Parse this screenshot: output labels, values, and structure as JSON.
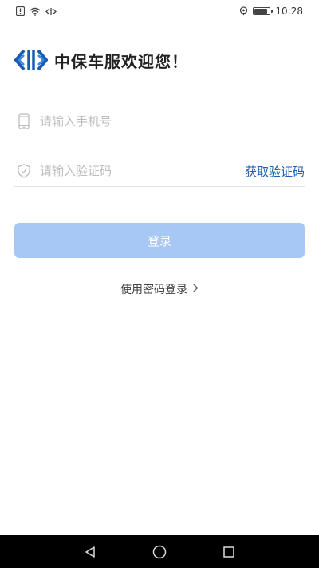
{
  "status_bar": {
    "time": "10:28",
    "icons": [
      "alert-icon",
      "wifi-icon",
      "data-icon",
      "location-icon",
      "battery-icon"
    ],
    "battery_level": 0.9
  },
  "header": {
    "logo": "brand-logo-icon",
    "welcome_text": "中保车服欢迎您！"
  },
  "form": {
    "phone": {
      "placeholder": "请输入手机号",
      "icon": "phone-icon"
    },
    "code": {
      "placeholder": "请输入验证码",
      "icon": "shield-icon",
      "get_code_label": "获取验证码"
    },
    "login_label": "登录",
    "password_login_label": "使用密码登录"
  },
  "nav_bar": {
    "buttons": [
      "back-icon",
      "home-icon",
      "recents-icon"
    ]
  },
  "colors": {
    "brand_blue": "#1d5fb0",
    "button_disabled": "#a7c8f5"
  }
}
